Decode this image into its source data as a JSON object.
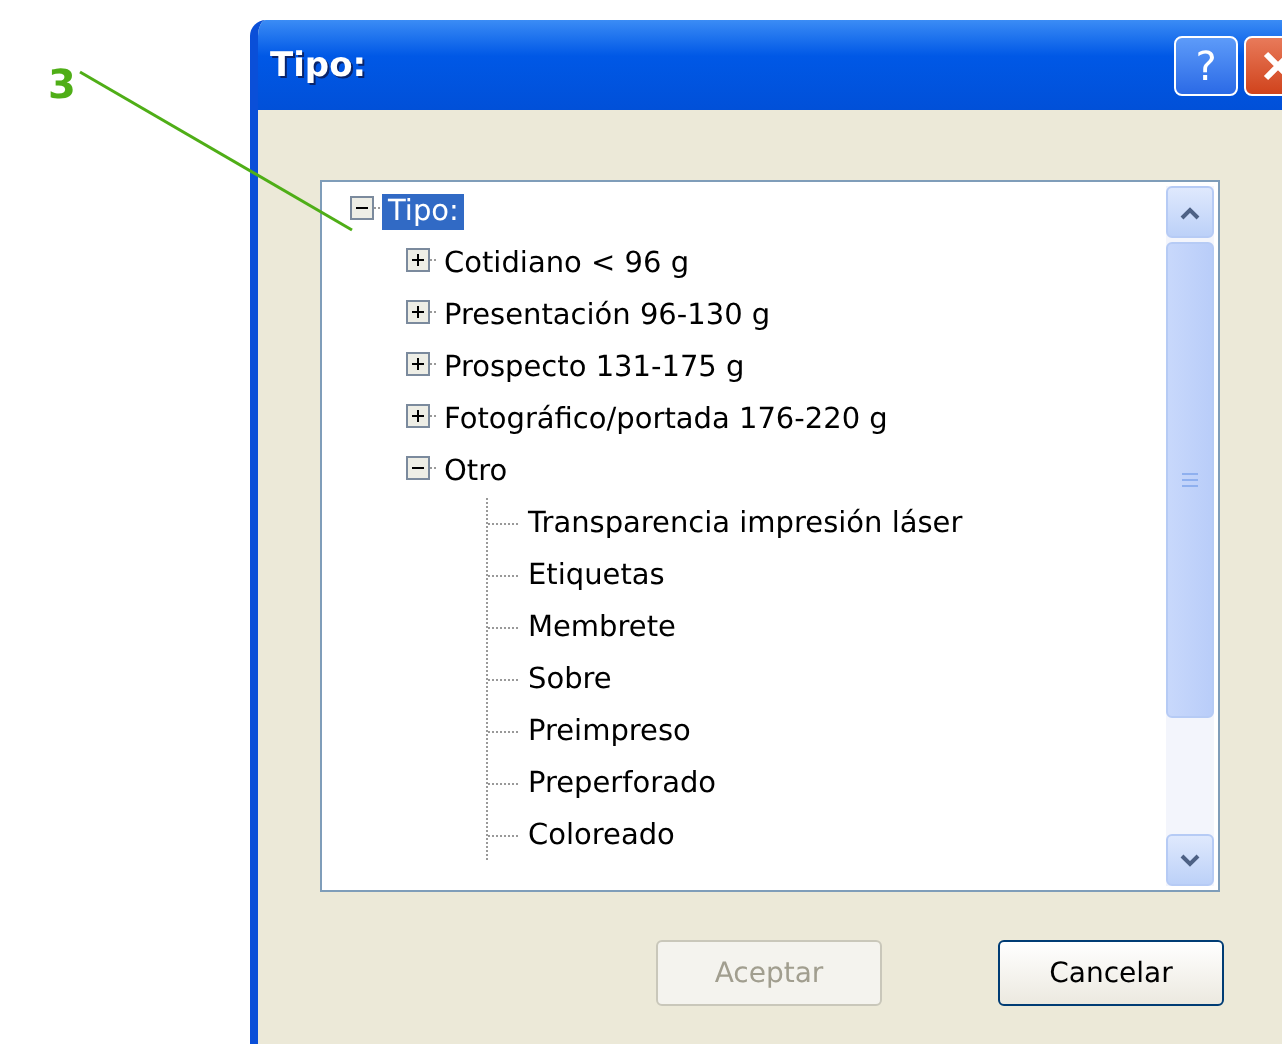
{
  "callout": {
    "label": "3"
  },
  "window": {
    "title": "Tipo:",
    "help_button": "?"
  },
  "tree": {
    "items": [
      {
        "label": "Tipo:",
        "expanded": true,
        "selected": true,
        "children": [
          {
            "label": "Cotidiano < 96 g",
            "expanded": false,
            "selected": false
          },
          {
            "label": "Presentación 96-130 g",
            "expanded": false,
            "selected": false
          },
          {
            "label": "Prospecto 131-175 g",
            "expanded": false,
            "selected": false
          },
          {
            "label": "Fotográfico/portada 176-220 g",
            "expanded": false,
            "selected": false
          },
          {
            "label": "Otro",
            "expanded": true,
            "selected": false,
            "children": [
              {
                "label": "Transparencia impresión láser",
                "selected": false
              },
              {
                "label": "Etiquetas",
                "selected": false
              },
              {
                "label": "Membrete",
                "selected": false
              },
              {
                "label": "Sobre",
                "selected": false
              },
              {
                "label": "Preimpreso",
                "selected": false
              },
              {
                "label": "Preperforado",
                "selected": false
              },
              {
                "label": "Coloreado",
                "selected": false
              }
            ]
          }
        ]
      }
    ]
  },
  "buttons": [
    {
      "label": "Aceptar",
      "disabled": true
    },
    {
      "label": "Cancelar",
      "disabled": false
    }
  ]
}
